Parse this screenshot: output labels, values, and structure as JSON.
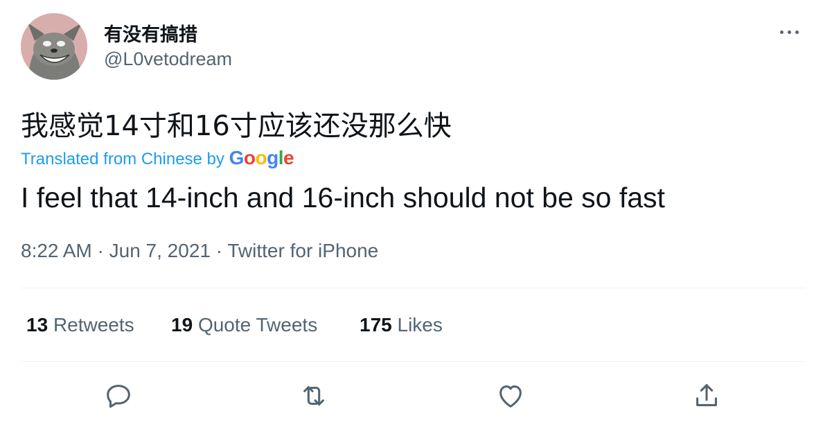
{
  "user": {
    "display_name": "有没有搞措",
    "handle": "@L0vetodream"
  },
  "tweet": {
    "text_original": "我感觉14寸和16寸应该还没那么快",
    "translation_prefix": "Translated from Chinese by ",
    "translation_provider": "Google",
    "text_translated": "I feel that 14-inch and 16-inch should not be so fast",
    "time": "8:22 AM",
    "date": "Jun 7, 2021",
    "source": "Twitter for iPhone",
    "separator": "·"
  },
  "stats": {
    "retweets_count": "13",
    "retweets_label": "Retweets",
    "quotes_count": "19",
    "quotes_label": "Quote Tweets",
    "likes_count": "175",
    "likes_label": "Likes"
  },
  "icons": [
    "more-icon",
    "reply-icon",
    "retweet-icon",
    "like-icon",
    "share-icon"
  ],
  "colors": {
    "text": "#0f1419",
    "muted": "#536471",
    "link": "#1d9bf0",
    "divider": "#eff3f4",
    "google_blue": "#4285f4",
    "google_red": "#ea4335",
    "google_yellow": "#fbbc05",
    "google_green": "#34a853"
  }
}
